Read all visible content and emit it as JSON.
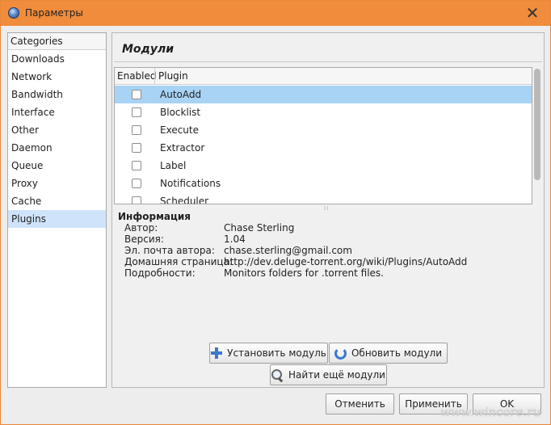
{
  "window": {
    "title": "Параметры",
    "close_glyph": "✕",
    "app_icon": "deluge-icon"
  },
  "categories": {
    "header": "Categories",
    "items": [
      {
        "label": "Downloads"
      },
      {
        "label": "Network"
      },
      {
        "label": "Bandwidth"
      },
      {
        "label": "Interface"
      },
      {
        "label": "Other"
      },
      {
        "label": "Daemon"
      },
      {
        "label": "Queue"
      },
      {
        "label": "Proxy"
      },
      {
        "label": "Cache"
      },
      {
        "label": "Plugins"
      }
    ],
    "selected": "Plugins"
  },
  "plugins": {
    "title": "Модули",
    "columns": {
      "enabled": "Enabled",
      "plugin": "Plugin"
    },
    "rows": [
      {
        "name": "AutoAdd",
        "enabled": false,
        "selected": true
      },
      {
        "name": "Blocklist",
        "enabled": false
      },
      {
        "name": "Execute",
        "enabled": false
      },
      {
        "name": "Extractor",
        "enabled": false
      },
      {
        "name": "Label",
        "enabled": false
      },
      {
        "name": "Notifications",
        "enabled": false
      },
      {
        "name": "Scheduler",
        "enabled": false
      }
    ]
  },
  "info": {
    "title": "Информация",
    "author_label": "Автор:",
    "author": "Chase Sterling",
    "version_label": "Версия:",
    "version": "1.04",
    "email_label": "Эл. почта автора:",
    "email": "chase.sterling@gmail.com",
    "homepage_label": "Домашняя страница:",
    "homepage": "http://dev.deluge-torrent.org/wiki/Plugins/AutoAdd",
    "details_label": "Подробности:",
    "details": "Monitors folders for .torrent files."
  },
  "actions": {
    "install": "Установить модуль",
    "update": "Обновить модули",
    "find_more": "Найти ещё модули"
  },
  "dialog_buttons": {
    "cancel": "Отменить",
    "apply": "Применить",
    "ok": "OK"
  },
  "watermark": "www.wincore.ru",
  "colors": {
    "titlebar": "#f08c3c",
    "selection": "#a8d3f5",
    "category_selection": "#cfe4fb"
  }
}
